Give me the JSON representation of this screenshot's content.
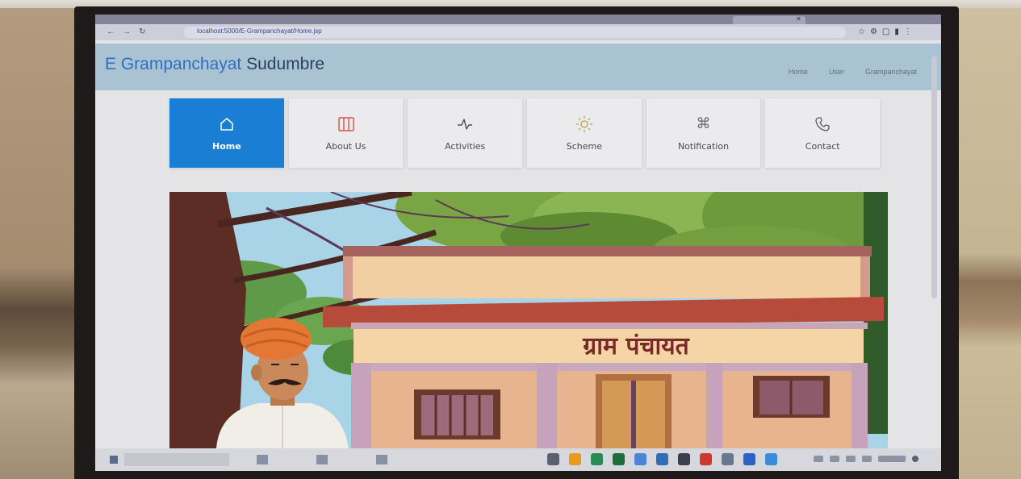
{
  "browser": {
    "url": "localhost:5000/E-Grampanchayat/Home.jsp"
  },
  "header": {
    "title_prefix": "E Grampanchayat",
    "title_suffix": "Sudumbre",
    "nav": [
      "Home",
      "User",
      "Grampanchayat"
    ]
  },
  "menu": [
    {
      "label": "Home",
      "icon": "home-icon",
      "active": true
    },
    {
      "label": "About Us",
      "icon": "book-icon",
      "active": false
    },
    {
      "label": "Activities",
      "icon": "activity-icon",
      "active": false
    },
    {
      "label": "Scheme",
      "icon": "sun-icon",
      "active": false
    },
    {
      "label": "Notification",
      "icon": "command-icon",
      "active": false
    },
    {
      "label": "Contact",
      "icon": "phone-icon",
      "active": false
    }
  ],
  "banner": {
    "sign_text": "ग्राम पंचायत"
  },
  "colors": {
    "accent": "#1a7fd4",
    "header_band": "#a9c3d2",
    "title_blue": "#2f6fc1",
    "about_icon": "#d9534f"
  },
  "taskbar": {
    "pinned": [
      {
        "icon": "taskview-icon",
        "color": "#5a6070"
      },
      {
        "icon": "edge-icon",
        "color": "#e79a1b"
      },
      {
        "icon": "explorer-icon",
        "color": "#2a8c54"
      },
      {
        "icon": "excel-icon",
        "color": "#1f6b3a"
      },
      {
        "icon": "chrome-icon",
        "color": "#4b84d8"
      },
      {
        "icon": "vscode-icon",
        "color": "#2f6db5"
      },
      {
        "icon": "app-icon",
        "color": "#3a3f4c"
      },
      {
        "icon": "pdf-icon",
        "color": "#d2372f"
      },
      {
        "icon": "settings-icon",
        "color": "#6a7590"
      },
      {
        "icon": "word-icon",
        "color": "#2b62c4"
      },
      {
        "icon": "store-icon",
        "color": "#3b8bd6"
      }
    ]
  }
}
